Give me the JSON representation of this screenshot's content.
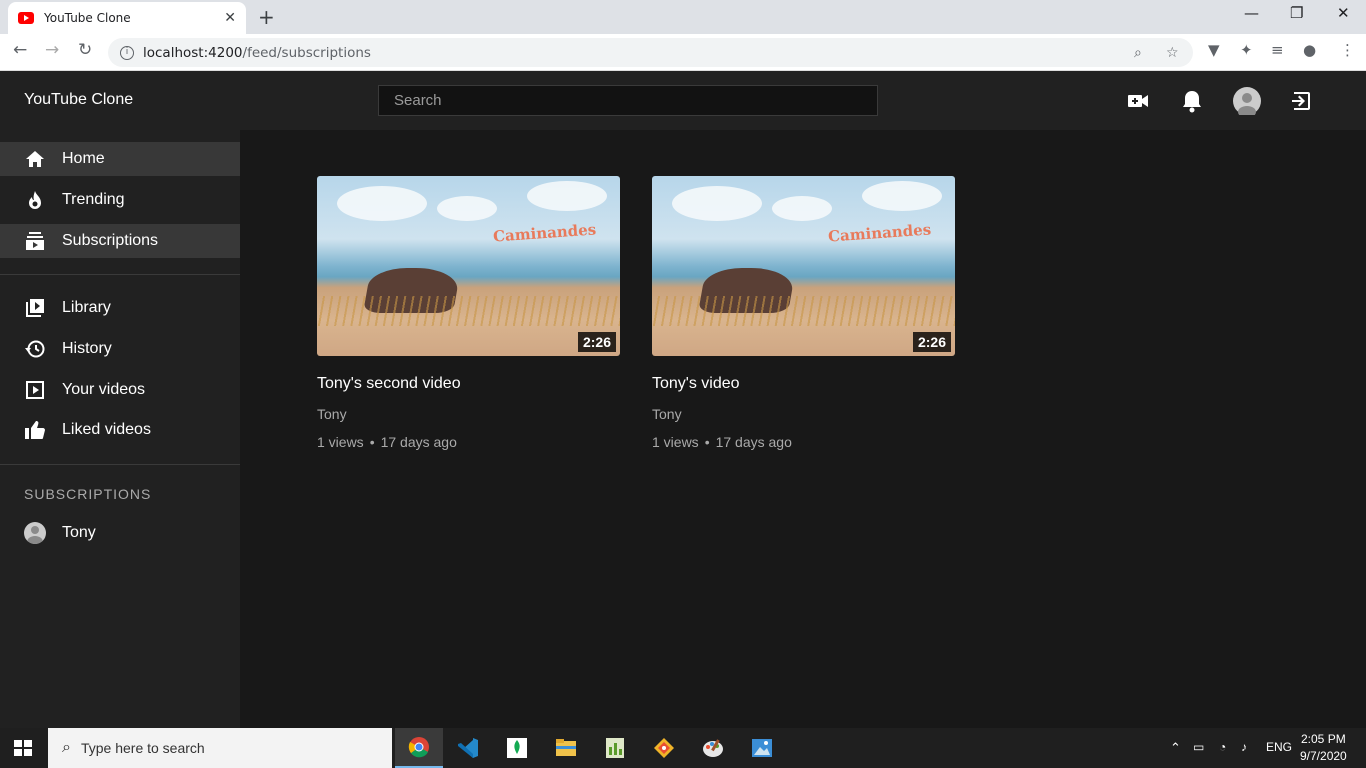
{
  "browser": {
    "tab_title": "YouTube Clone",
    "url_host": "localhost:4200",
    "url_path": "/feed/subscriptions"
  },
  "app": {
    "brand": "YouTube Clone",
    "search_placeholder": "Search"
  },
  "sidebar": {
    "items": [
      {
        "label": "Home",
        "icon": "home-icon"
      },
      {
        "label": "Trending",
        "icon": "fire-icon"
      },
      {
        "label": "Subscriptions",
        "icon": "subscriptions-icon"
      },
      {
        "label": "Library",
        "icon": "library-icon"
      },
      {
        "label": "History",
        "icon": "history-icon"
      },
      {
        "label": "Your videos",
        "icon": "your-videos-icon"
      },
      {
        "label": "Liked videos",
        "icon": "thumbs-up-icon"
      }
    ],
    "subscriptions_heading": "SUBSCRIPTIONS",
    "subscriptions": [
      {
        "name": "Tony"
      }
    ]
  },
  "videos": [
    {
      "title": "Tony's second video",
      "channel": "Tony",
      "views": "1 views",
      "age": "17 days ago",
      "duration": "2:26",
      "thumb_logo": "Caminandes"
    },
    {
      "title": "Tony's video",
      "channel": "Tony",
      "views": "1 views",
      "age": "17 days ago",
      "duration": "2:26",
      "thumb_logo": "Caminandes"
    }
  ],
  "taskbar": {
    "search_placeholder": "Type here to search",
    "language": "ENG",
    "time": "2:05 PM",
    "date": "9/7/2020"
  }
}
